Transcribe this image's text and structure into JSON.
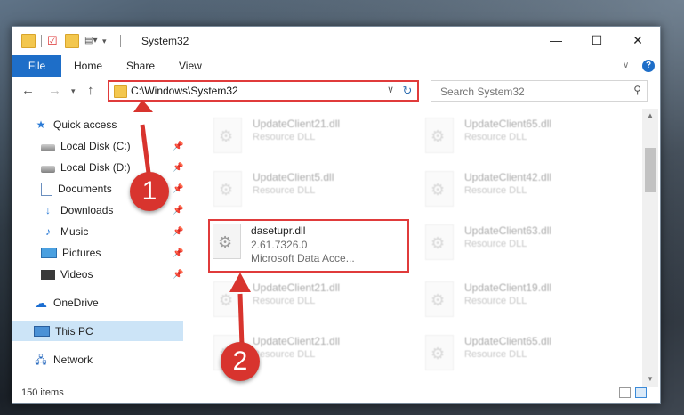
{
  "window": {
    "title": "System32",
    "controls": {
      "minimize": "—",
      "maximize": "☐",
      "close": "✕"
    }
  },
  "ribbon": {
    "tabs": [
      "File",
      "Home",
      "Share",
      "View"
    ],
    "help": "?"
  },
  "address": {
    "path": "C:\\Windows\\System32",
    "search_placeholder": "Search System32"
  },
  "sidebar": {
    "items": [
      {
        "label": "Quick access",
        "icon": "star-icon"
      },
      {
        "label": "Local Disk (C:)",
        "icon": "drive-icon",
        "pinned": true
      },
      {
        "label": "Local Disk (D:)",
        "icon": "drive-icon",
        "pinned": true
      },
      {
        "label": "Documents",
        "icon": "document-icon",
        "pinned": true
      },
      {
        "label": "Downloads",
        "icon": "download-icon",
        "pinned": true
      },
      {
        "label": "Music",
        "icon": "music-icon",
        "pinned": true
      },
      {
        "label": "Pictures",
        "icon": "pictures-icon",
        "pinned": true
      },
      {
        "label": "Videos",
        "icon": "videos-icon",
        "pinned": true
      },
      {
        "label": "OneDrive",
        "icon": "onedrive-icon"
      },
      {
        "label": "This PC",
        "icon": "computer-icon",
        "selected": true
      },
      {
        "label": "Network",
        "icon": "network-icon"
      }
    ]
  },
  "files": [
    {
      "name": "UpdateClient21.dll",
      "type": "Resource DLL"
    },
    {
      "name": "UpdateClient65.dll",
      "type": "Resource DLL"
    },
    {
      "name": "UpdateClient5.dll",
      "type": "Resource DLL"
    },
    {
      "name": "UpdateClient42.dll",
      "type": "Resource DLL"
    },
    {
      "name": "dasetupr.dll",
      "version": "2.61.7326.0",
      "description": "Microsoft Data Acce...",
      "highlighted": true
    },
    {
      "name": "UpdateClient63.dll",
      "type": "Resource DLL"
    },
    {
      "name": "UpdateClient21.dll",
      "type": "Resource DLL"
    },
    {
      "name": "UpdateClient19.dll",
      "type": "Resource DLL"
    },
    {
      "name": "UpdateClient21.dll",
      "type": "Resource DLL"
    },
    {
      "name": "UpdateClient65.dll",
      "type": "Resource DLL"
    }
  ],
  "status": {
    "item_count": "150 items"
  },
  "annotations": {
    "step1": "1",
    "step2": "2",
    "color": "#d8342e"
  }
}
